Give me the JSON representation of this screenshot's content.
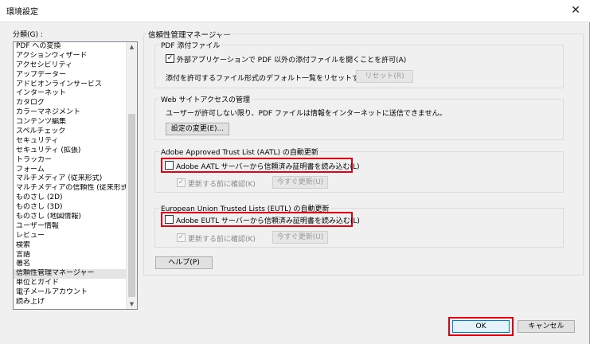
{
  "window": {
    "title": "環境設定",
    "close_glyph": "✕"
  },
  "categories": {
    "label": "分類(G) :",
    "items": [
      "PDF への変換",
      "アクションウィザード",
      "アクセシビリティ",
      "アップデーター",
      "アドビオンラインサービス",
      "インターネット",
      "カタログ",
      "カラーマネジメント",
      "コンテンツ編集",
      "スペルチェック",
      "セキュリティ",
      "セキュリティ (拡張)",
      "トラッカー",
      "フォーム",
      "マルチメディア (従来形式)",
      "マルチメディアの信頼性 (従来形式)",
      "ものさし (2D)",
      "ものさし (3D)",
      "ものさし (地図情報)",
      "ユーザー情報",
      "レビュー",
      "検索",
      "言語",
      "署名",
      "信頼性管理マネージャー",
      "単位とガイド",
      "電子メールアカウント",
      "読み上げ"
    ],
    "selected": "信頼性管理マネージャー"
  },
  "main": {
    "title": "信頼性管理マネージャー",
    "pdf_attachments": {
      "label": "PDF 添付ファイル",
      "allow_checkbox_label": "外部アプリケーションで PDF 以外の添付ファイルを開くことを許可(A)",
      "allow_checked": true,
      "reset_text": "添付を許可するファイル形式のデフォルト一覧をリセットする :",
      "reset_button": "リセット(R)"
    },
    "web_access": {
      "label": "Web サイトアクセスの管理",
      "description": "ユーザーが許可しない限り、PDF ファイルは情報をインターネットに送信できません。",
      "change_button": "設定の変更(E)..."
    },
    "aatl": {
      "label": "Adobe Approved Trust List (AATL) の自動更新",
      "load_checkbox_label": "Adobe AATL サーバーから信頼済み証明書を読み込む(L)",
      "load_checked": false,
      "confirm_label": "更新する前に確認(K)",
      "confirm_checked": true,
      "update_button": "今すぐ更新(U)"
    },
    "eutl": {
      "label": "European Union Trusted Lists (EUTL) の自動更新",
      "load_checkbox_label": "Adobe EUTL サーバーから信頼済み証明書を読み込む(L)",
      "load_checked": false,
      "confirm_label": "更新する前に確認(K)",
      "confirm_checked": true,
      "update_button": "今すぐ更新(U)"
    },
    "help_button": "ヘルプ(P)"
  },
  "footer": {
    "ok_button": "OK",
    "cancel_button": "キャンセル"
  },
  "colors": {
    "highlight": "#e60012",
    "accent": "#0078d7"
  },
  "glyphs": {
    "check": "✓",
    "up_arrow": "▲",
    "down_arrow": "▼"
  }
}
